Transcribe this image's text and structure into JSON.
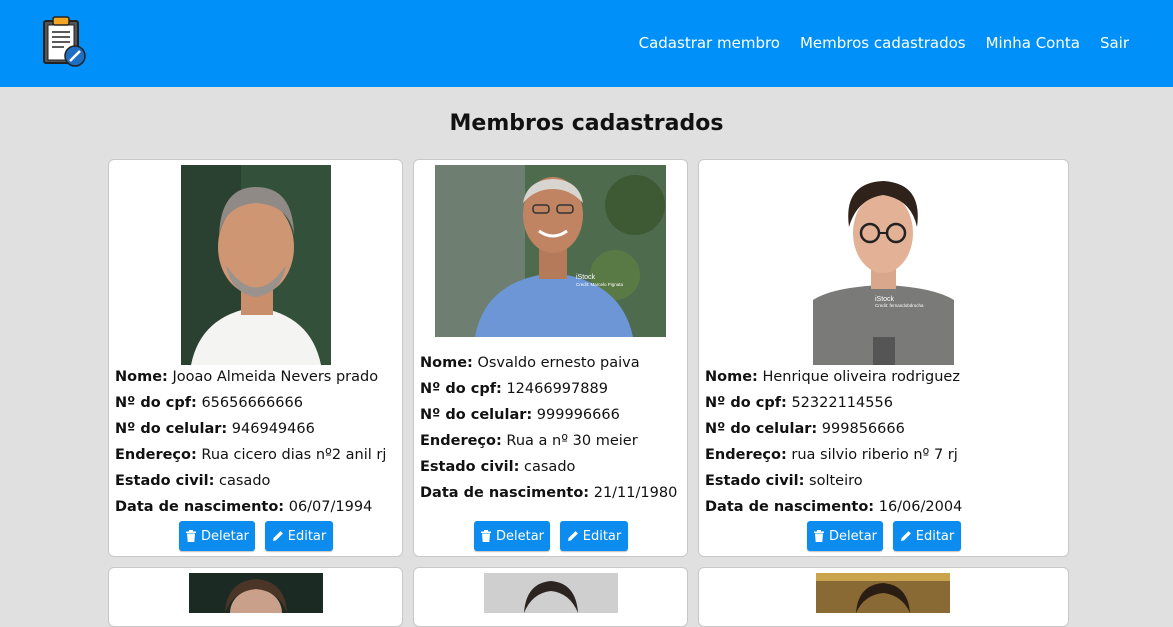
{
  "nav": {
    "links": [
      "Cadastrar membro",
      "Membros cadastrados",
      "Minha Conta",
      "Sair"
    ]
  },
  "page": {
    "title": "Membros cadastrados"
  },
  "labels": {
    "nome": "Nome:",
    "cpf": "Nº do cpf:",
    "celular": "Nº do celular:",
    "endereco": "Endereço:",
    "estado_civil": "Estado civil:",
    "nascimento": "Data de nascimento:",
    "delete": "Deletar",
    "edit": "Editar"
  },
  "members": [
    {
      "nome": "Jooao Almeida Nevers prado",
      "cpf": "65656666666",
      "celular": "946949466",
      "endereco": "Rua cicero dias nº2 anil rj",
      "estado_civil": "casado",
      "nascimento": "06/07/1994"
    },
    {
      "nome": "Osvaldo ernesto paiva",
      "cpf": "12466997889",
      "celular": "999996666",
      "endereco": "Rua a nº 30 meier",
      "estado_civil": "casado",
      "nascimento": "21/11/1980",
      "photo_watermark": [
        "iStock",
        "Credit: Marcelo Pignata"
      ]
    },
    {
      "nome": "Henrique oliveira rodriguez",
      "cpf": "52322114556",
      "celular": "999856666",
      "endereco": "rua silvio riberio nº 7 rj",
      "estado_civil": "solteiro",
      "nascimento": "16/06/2004",
      "photo_watermark": [
        "iStock",
        "Credit: fernandobdrocha"
      ]
    }
  ]
}
